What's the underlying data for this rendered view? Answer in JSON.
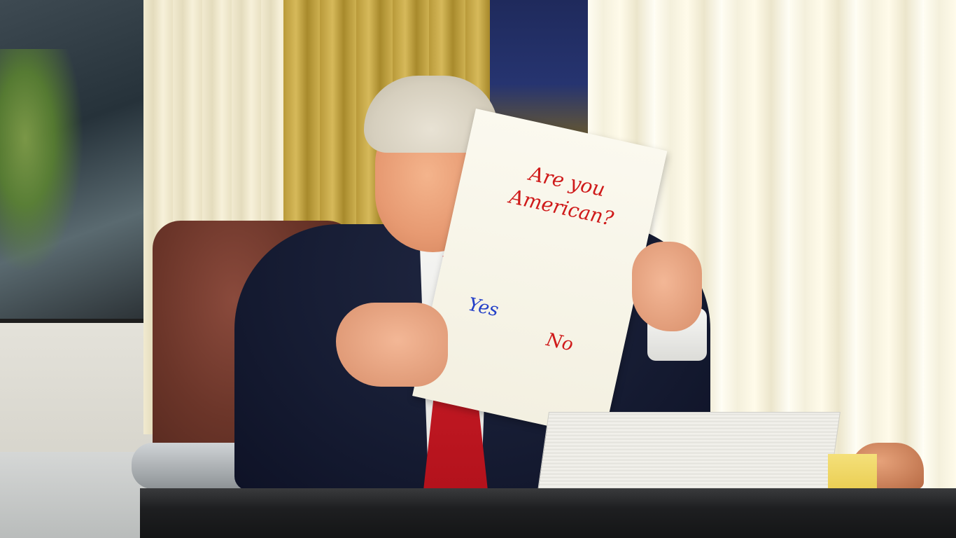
{
  "photo": {
    "description_alt": "Man in a suit at a desk holding up a handwritten sign"
  },
  "sign": {
    "question": "Are you American?",
    "option_yes": "Yes",
    "option_no": "No",
    "colors": {
      "question": "#cf1a1a",
      "yes": "#2440c8",
      "no": "#cf1a1a"
    }
  }
}
